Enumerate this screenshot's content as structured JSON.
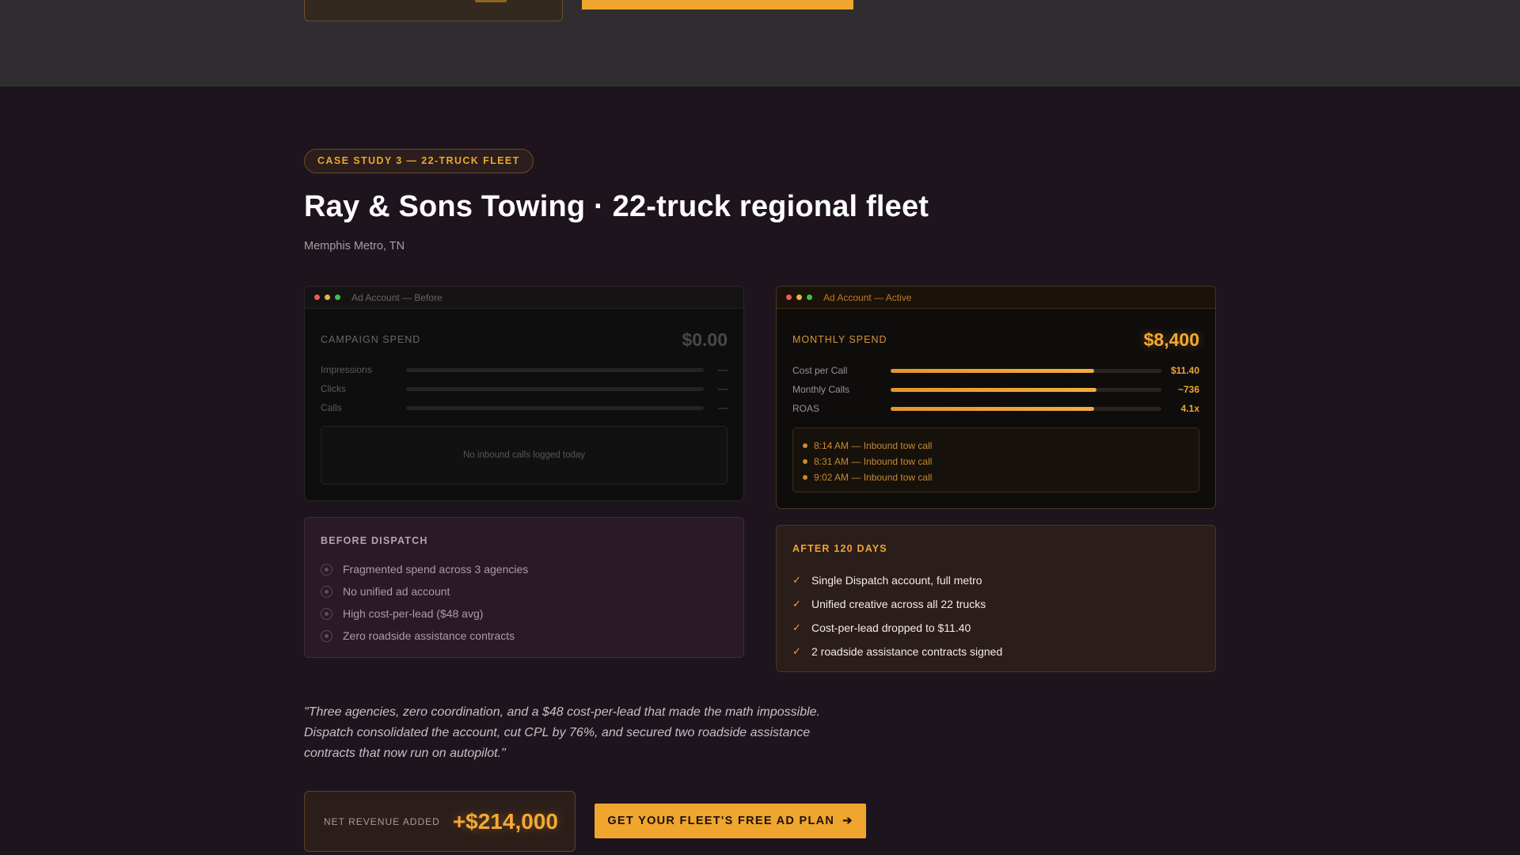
{
  "badge": "CASE STUDY 3 — 22-TRUCK FLEET",
  "title": "Ray & Sons Towing · 22-truck regional fleet",
  "location": "Memphis Metro, TN",
  "before_window": {
    "title": "Ad Account — Before",
    "spend_label": "CAMPAIGN SPEND",
    "spend_value": "$0.00",
    "metrics": [
      {
        "label": "Impressions",
        "value": "—",
        "fill": 0
      },
      {
        "label": "Clicks",
        "value": "—",
        "fill": 0
      },
      {
        "label": "Calls",
        "value": "—",
        "fill": 0
      }
    ],
    "empty_text": "No inbound calls logged today"
  },
  "after_window": {
    "title": "Ad Account — Active",
    "spend_label": "MONTHLY SPEND",
    "spend_value": "$8,400",
    "metrics": [
      {
        "label": "Cost per Call",
        "value": "$11.40",
        "fill": 0.75
      },
      {
        "label": "Monthly Calls",
        "value": "~736",
        "fill": 0.76
      },
      {
        "label": "ROAS",
        "value": "4.1x",
        "fill": 0.75
      }
    ],
    "calls": [
      "8:14 AM — Inbound tow call",
      "8:31 AM — Inbound tow call",
      "9:02 AM — Inbound tow call"
    ]
  },
  "before": {
    "heading": "BEFORE DISPATCH",
    "items": [
      "Fragmented spend across 3 agencies",
      "No unified ad account",
      "High cost-per-lead ($48 avg)",
      "Zero roadside assistance contracts"
    ]
  },
  "after": {
    "heading": "AFTER 120 DAYS",
    "check_glyph": "✓",
    "items": [
      "Single Dispatch account, full metro",
      "Unified creative across all 22 trucks",
      "Cost-per-lead dropped to $11.40",
      "2 roadside assistance contracts signed"
    ]
  },
  "quote": "\"Three agencies, zero coordination, and a $48 cost-per-lead that made the math impossible. Dispatch consolidated the account, cut CPL by 76%, and secured two roadside assistance contracts that now run on autopilot.\"",
  "revenue": {
    "label": "NET REVENUE ADDED",
    "value": "+$214,000"
  },
  "cta": {
    "label": "GET YOUR FLEET'S FREE AD PLAN",
    "arrow": "➔"
  },
  "colors": {
    "accent": "#f0a52e",
    "background": "#1e141d",
    "before_card": "#2a1a28",
    "after_card": "#2b1d1a"
  },
  "icons": [
    "window-close-dot",
    "window-minimize-dot",
    "window-maximize-dot",
    "check-icon",
    "radio-bullet-icon",
    "arrow-right-icon"
  ]
}
